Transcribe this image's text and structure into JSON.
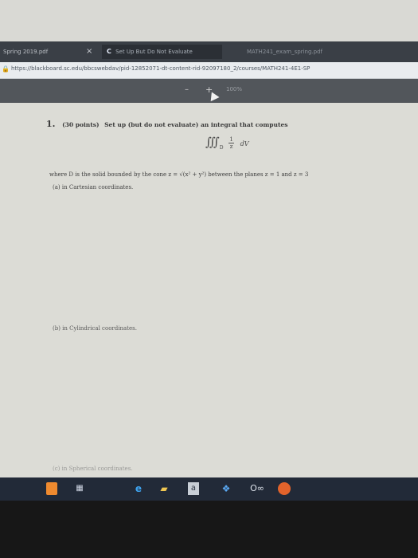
{
  "browser": {
    "tabs": [
      {
        "label": "Spring 2019.pdf"
      },
      {
        "label": "Set Up But Do Not Evaluate"
      },
      {
        "label": "MATH241_exam_spring.pdf"
      }
    ],
    "tab_close": "×",
    "chrome_icon": "C",
    "url": "https://blackboard.sc.edu/bbcswebdav/pid-12852071-dt-content-rid-92097180_2/courses/MATH241-4E1-SP"
  },
  "pdf_toolbar": {
    "zoom_out": "–",
    "zoom_in": "+",
    "zoom_level": "100%"
  },
  "question": {
    "number": "1.",
    "points": "(30 points)",
    "prompt": "Set up (but do not evaluate) an integral that computes",
    "integral_symbol": "∭",
    "integral_region": "D",
    "integrand_numerator": "1",
    "integrand_denominator": "z",
    "differential": "dV",
    "region_text": "where D is the solid bounded by the cone z = √(x² + y²) between the planes z = 1 and z = 3",
    "parts": [
      {
        "label": "(a) in Cartesian coordinates."
      },
      {
        "label": "(b) in Cylindrical coordinates."
      },
      {
        "label": "(c) in Spherical coordinates."
      }
    ]
  },
  "taskbar": {
    "text_app": "a",
    "onenote": "O∞"
  },
  "colors": {
    "tab_bar": "#3a3f46",
    "pdf_toolbar": "#52565b",
    "page_bg": "#dcdcd6",
    "taskbar": "#222a38",
    "firefox": "#e2632b"
  }
}
